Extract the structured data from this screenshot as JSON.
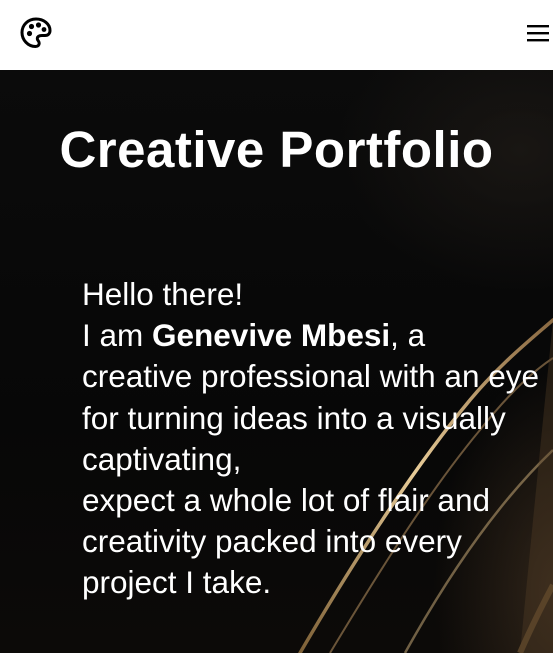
{
  "header": {
    "logo_icon": "palette-icon",
    "menu_icon": "hamburger-menu-icon"
  },
  "hero": {
    "title": "Creative Portfolio",
    "greeting": "Hello there!",
    "intro_prefix": "I am ",
    "name": "Genevive Mbesi",
    "intro_suffix": ", a creative professional with an eye for turning ideas into a visually captivating,",
    "closing": "expect a whole lot of flair and creativity packed into every project I take."
  },
  "colors": {
    "header_bg": "#ffffff",
    "hero_bg": "#0a0a0a",
    "text": "#ffffff",
    "accent_gold": "#c9a56a"
  }
}
